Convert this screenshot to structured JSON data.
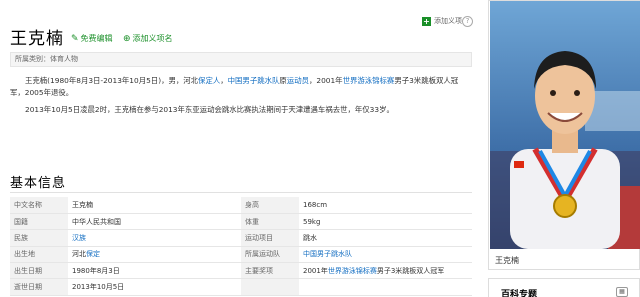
{
  "header": {
    "title": "王克楠",
    "edit_label": "免费编辑",
    "add_meaning_label": "添加义项名",
    "add_top_label": "添加义项"
  },
  "category": "所属类别：体育人物",
  "summary": {
    "p1": [
      {
        "text": "王克楠(1980年8月3日-2013年10月5日)，男，河北",
        "link": false
      },
      {
        "text": "保定人",
        "link": true
      },
      {
        "text": "，",
        "link": false
      },
      {
        "text": "中国男子跳水队",
        "link": true
      },
      {
        "text": "原",
        "link": false
      },
      {
        "text": "运动员",
        "link": true
      },
      {
        "text": "，2001年",
        "link": false
      },
      {
        "text": "世界游泳锦标赛",
        "link": true
      },
      {
        "text": "男子3米跳板双人冠军，2005年退役。",
        "link": false
      }
    ],
    "p2": "2013年10月5日凌晨2时，王克楠在参与2013年东亚运动会跳水比赛执法期间于天津遭遇车祸去世，年仅33岁。"
  },
  "basic_info": {
    "title": "基本信息",
    "rows": [
      [
        {
          "k": "中文名称",
          "v": [
            {
              "text": "王克楠",
              "link": false
            }
          ]
        },
        {
          "k": "身高",
          "v": [
            {
              "text": "168cm",
              "link": false
            }
          ]
        }
      ],
      [
        {
          "k": "国籍",
          "v": [
            {
              "text": "中华人民共和国",
              "link": false
            }
          ]
        },
        {
          "k": "体重",
          "v": [
            {
              "text": "59kg",
              "link": false
            }
          ]
        }
      ],
      [
        {
          "k": "民族",
          "v": [
            {
              "text": "汉族",
              "link": true
            }
          ]
        },
        {
          "k": "运动项目",
          "v": [
            {
              "text": "跳水",
              "link": false
            }
          ]
        }
      ],
      [
        {
          "k": "出生地",
          "v": [
            {
              "text": "河北",
              "link": false
            },
            {
              "text": "保定",
              "link": true
            }
          ]
        },
        {
          "k": "所属运动队",
          "v": [
            {
              "text": "中国男子跳水队",
              "link": true
            }
          ]
        }
      ],
      [
        {
          "k": "出生日期",
          "v": [
            {
              "text": "1980年8月3日",
              "link": false
            }
          ]
        },
        {
          "k": "主要奖项",
          "v": [
            {
              "text": "2001年",
              "link": false
            },
            {
              "text": "世界游泳锦标赛",
              "link": true
            },
            {
              "text": "男子3米跳板双人冠军",
              "link": false
            }
          ]
        }
      ],
      [
        {
          "k": "逝世日期",
          "v": [
            {
              "text": "2013年10月5日",
              "link": false
            }
          ]
        },
        {
          "k": "",
          "v": []
        }
      ]
    ]
  },
  "image_panel": {
    "caption": "王克楠"
  },
  "baike_panel": {
    "title": "百科专题"
  },
  "colors": {
    "link": "#136ec2",
    "green": "#1a8f28"
  }
}
